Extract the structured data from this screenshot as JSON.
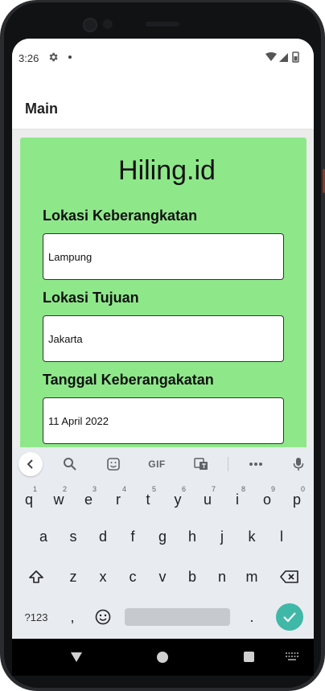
{
  "status": {
    "time": "3:26"
  },
  "appbar": {
    "title": "Main"
  },
  "app": {
    "title": "Hiling.id"
  },
  "form": {
    "fields": [
      {
        "label": "Lokasi Keberangkatan",
        "value": "Lampung"
      },
      {
        "label": "Lokasi Tujuan",
        "value": "Jakarta"
      },
      {
        "label": "Tanggal Keberangakatan",
        "value": "11 April 2022"
      }
    ]
  },
  "keyboard": {
    "toolbar": {
      "gif_label": "GIF"
    },
    "row1": [
      {
        "key": "q",
        "hint": "1"
      },
      {
        "key": "w",
        "hint": "2"
      },
      {
        "key": "e",
        "hint": "3"
      },
      {
        "key": "r",
        "hint": "4"
      },
      {
        "key": "t",
        "hint": "5"
      },
      {
        "key": "y",
        "hint": "6"
      },
      {
        "key": "u",
        "hint": "7"
      },
      {
        "key": "i",
        "hint": "8"
      },
      {
        "key": "o",
        "hint": "9"
      },
      {
        "key": "p",
        "hint": "0"
      }
    ],
    "row2": [
      "a",
      "s",
      "d",
      "f",
      "g",
      "h",
      "j",
      "k",
      "l"
    ],
    "row3": [
      "z",
      "x",
      "c",
      "v",
      "b",
      "n",
      "m"
    ],
    "symbols_label": "?123",
    "comma": ",",
    "period": "."
  },
  "colors": {
    "card": "#8ee88a",
    "enter_key": "#3fb8a8"
  }
}
